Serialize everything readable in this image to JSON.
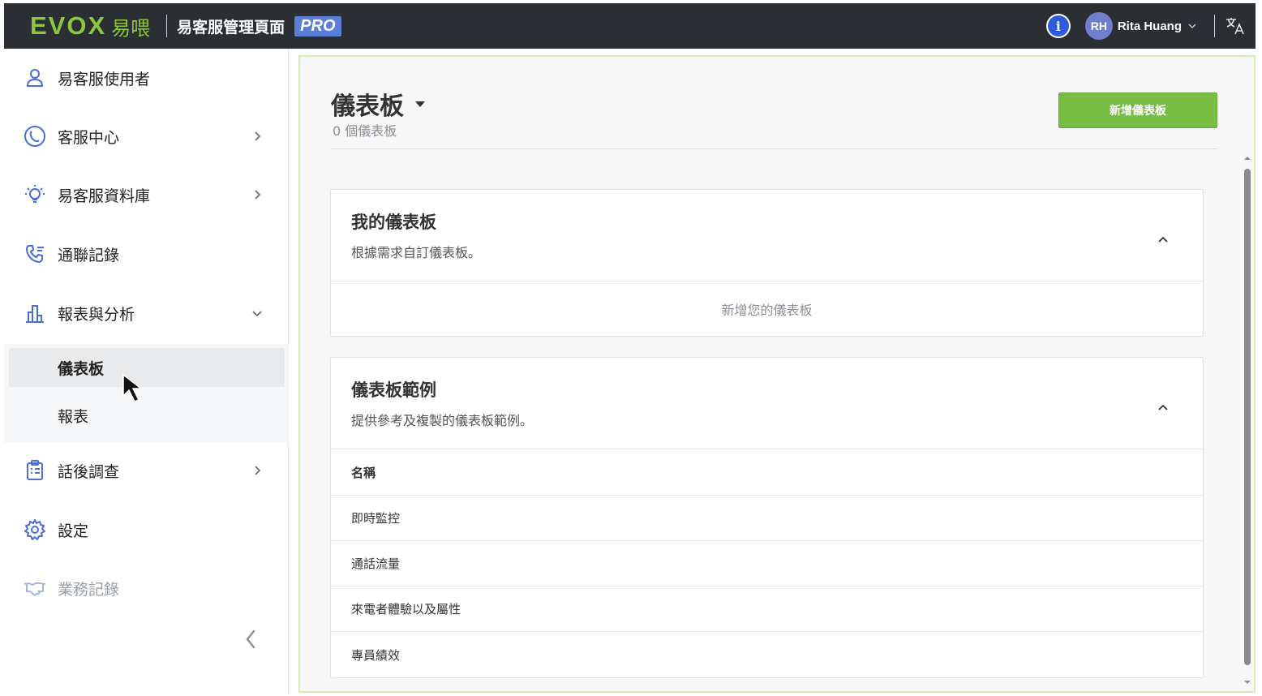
{
  "header": {
    "logo_text": "EVOX",
    "logo_cn": "易喂",
    "title": "易客服管理頁面",
    "badge": "PRO",
    "info_label": "i",
    "user_initials": "RH",
    "user_name": "Rita Huang",
    "icons": [
      "info-icon",
      "chevron-down-icon",
      "translate-icon"
    ]
  },
  "sidebar": {
    "items": [
      {
        "label": "易客服使用者",
        "icon": "user-icon"
      },
      {
        "label": "客服中心",
        "icon": "service-center-icon"
      },
      {
        "label": "易客服資料庫",
        "icon": "lightbulb-icon"
      },
      {
        "label": "通聯記錄",
        "icon": "phone-log-icon"
      },
      {
        "label": "報表與分析",
        "icon": "bar-chart-icon"
      },
      {
        "label": "話後調查",
        "icon": "clipboard-icon"
      },
      {
        "label": "設定",
        "icon": "gear-icon"
      },
      {
        "label": "業務記錄",
        "icon": "handshake-icon"
      }
    ],
    "sub_items": [
      {
        "label": "儀表板",
        "active": true
      },
      {
        "label": "報表",
        "active": false
      }
    ]
  },
  "main": {
    "title": "儀表板",
    "subtitle": "0 個儀表板",
    "add_button": "新增儀表板",
    "my_dashboards": {
      "title": "我的儀表板",
      "description": "根據需求自訂儀表板。",
      "empty_text": "新增您的儀表板"
    },
    "examples": {
      "title": "儀表板範例",
      "description": "提供參考及複製的儀表板範例。",
      "column_header": "名稱",
      "rows": [
        "即時監控",
        "通話流量",
        "來電者體驗以及屬性",
        "專員績效"
      ]
    }
  },
  "colors": {
    "topbar": "#2b2f33",
    "brand_green": "#8cc63f",
    "button_green": "#79bd45",
    "pro_badge": "#5b7fd6",
    "info_blue": "#2e5bd9"
  }
}
